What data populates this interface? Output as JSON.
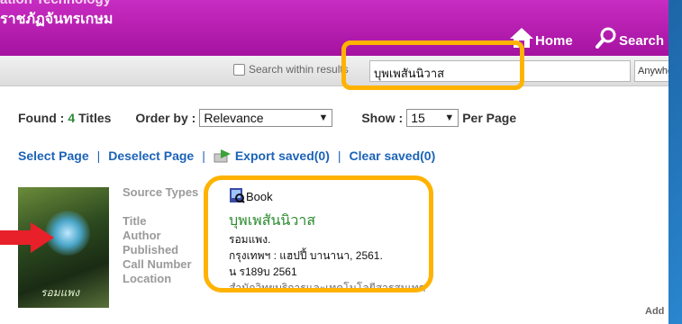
{
  "header": {
    "brand_top": "ation Technology",
    "brand_sub": "ราชภัฏจันทรเกษม",
    "nav_home": "Home",
    "nav_search": "Search"
  },
  "search": {
    "within_label": "Search within results",
    "query": "บุพเพสันนิวาส",
    "field_scope": "Anywhere"
  },
  "results": {
    "found_label": "Found :",
    "found_count": "4",
    "found_unit": "Titles",
    "order_label": "Order by :",
    "order_value": "Relevance",
    "show_label": "Show :",
    "show_value": "15",
    "per_page_label": "Per Page"
  },
  "actions": {
    "select_page": "Select Page",
    "deselect_page": "Deselect Page",
    "export_saved": "Export saved(0)",
    "clear_saved": "Clear saved(0)"
  },
  "record": {
    "cover_text": "รอมแพง",
    "labels": {
      "source_types": "Source Types",
      "title": "Title",
      "author": "Author",
      "published": "Published",
      "call_number": "Call Number",
      "location": "Location"
    },
    "source_type": "Book",
    "title": "บุพเพสันนิวาส",
    "author": "รอมแพง.",
    "published": "กรุงเทพฯ : แฮปปี้ บานานา, 2561.",
    "call_number": "น ร189บ 2561",
    "location": "สำนักวิทยบริการและเทคโนโลยีสารสนเทศ"
  },
  "footer": {
    "add_label": "Add"
  },
  "colors": {
    "header": "#b21aad",
    "highlight": "#ffb300",
    "link": "#1c63b7",
    "title": "#2b8a2f",
    "arrow": "#e8202a"
  }
}
